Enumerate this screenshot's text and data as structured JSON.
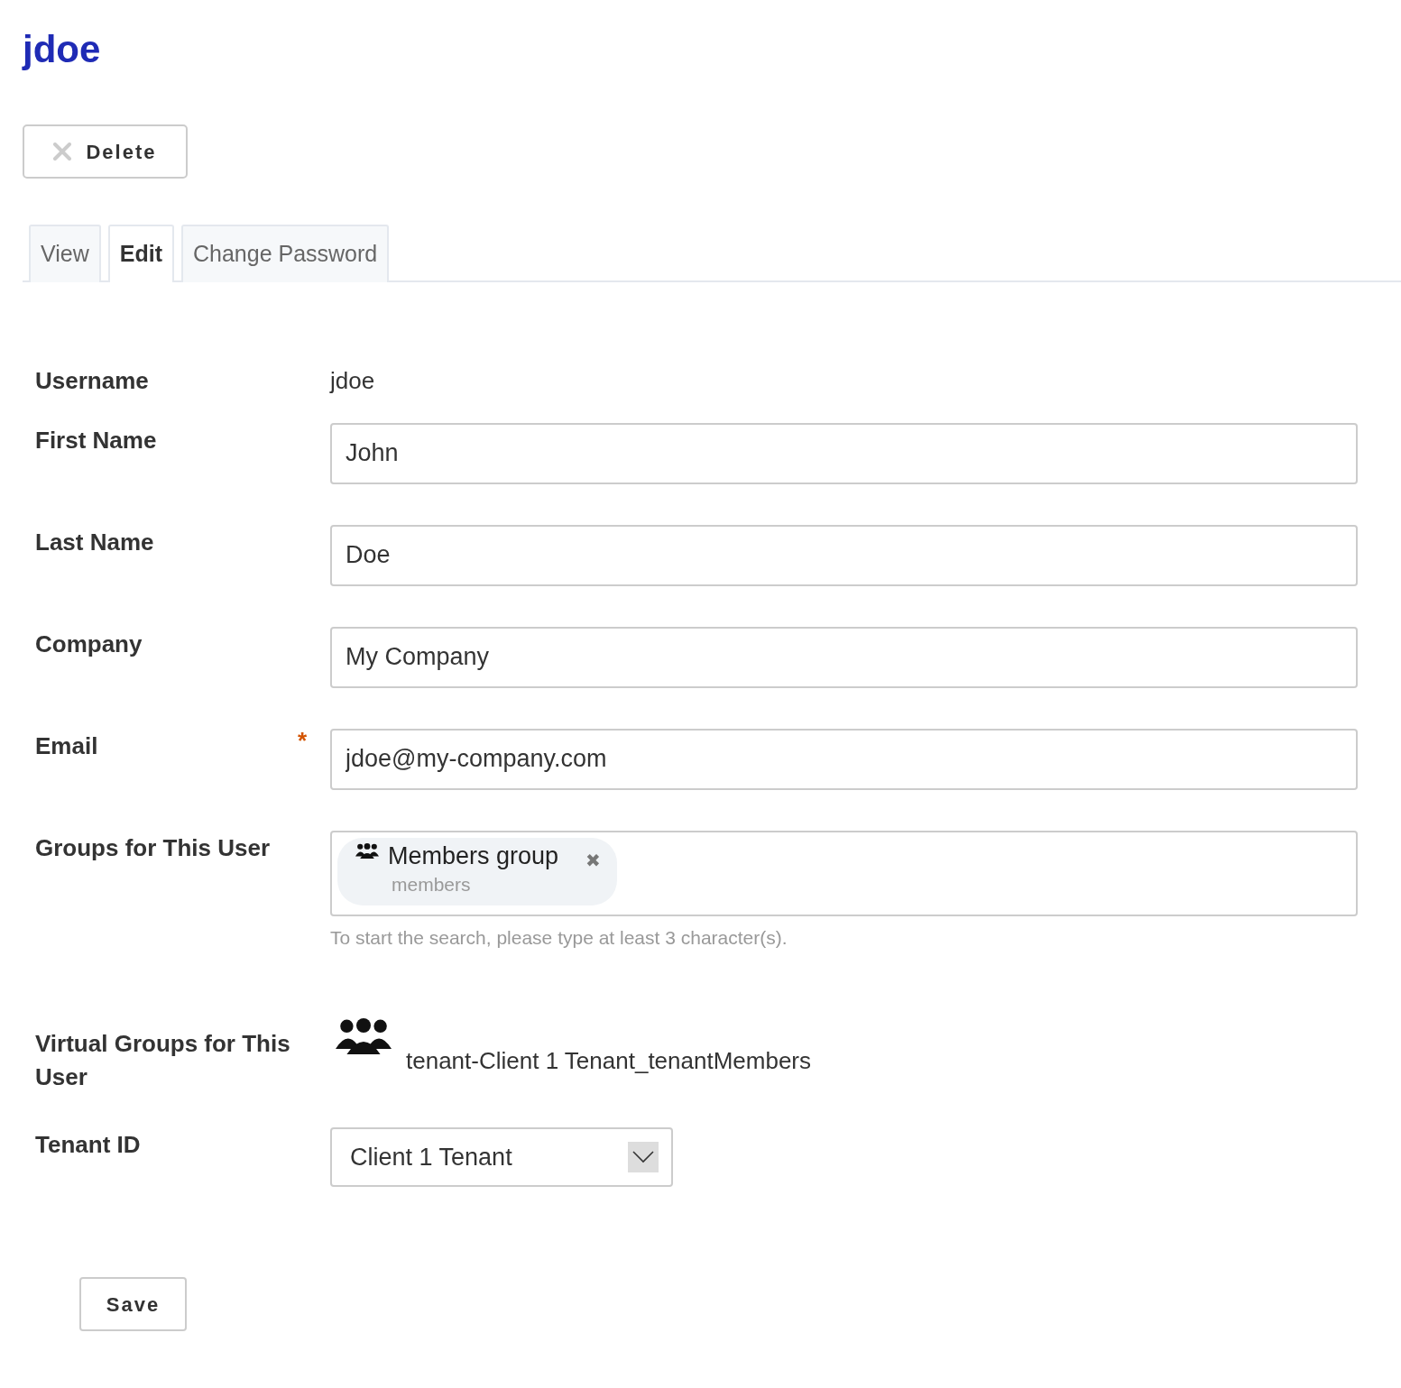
{
  "title": "jdoe",
  "delete_button": {
    "label": "Delete"
  },
  "tabs": [
    {
      "label": "View",
      "selected": false
    },
    {
      "label": "Edit",
      "selected": true
    },
    {
      "label": "Change Password",
      "selected": false
    }
  ],
  "fields": [
    {
      "kind": "static",
      "label": "Username",
      "value": "jdoe"
    },
    {
      "kind": "text",
      "label": "First Name",
      "value": "John"
    },
    {
      "kind": "text",
      "label": "Last Name",
      "value": "Doe"
    },
    {
      "kind": "text",
      "label": "Company",
      "value": "My Company"
    },
    {
      "kind": "text",
      "label": "Email",
      "value": "jdoe@my-company.com",
      "required_mark": "*"
    },
    {
      "kind": "tags",
      "label": "Groups for This User",
      "tags": [
        {
          "title": "Members group",
          "subtitle": "members",
          "remove": "✖"
        }
      ],
      "help": "To start the search, please type at least 3 character(s)."
    },
    {
      "kind": "virtual",
      "label": "Virtual Groups for This User",
      "items": [
        "tenant-Client 1 Tenant_tenantMembers"
      ]
    },
    {
      "kind": "select",
      "label": "Tenant ID",
      "value": "Client 1 Tenant"
    }
  ],
  "save_button": {
    "label": "Save"
  }
}
